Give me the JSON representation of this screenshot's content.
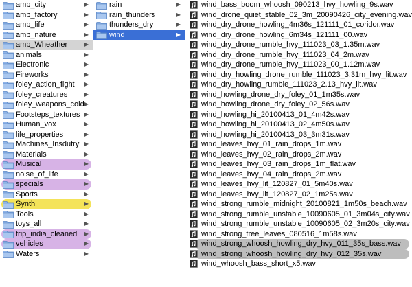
{
  "colors": {
    "selection_blue": "#3a6fd6",
    "selection_grey": "#d4d4d4",
    "tag_purple": "#d7b3e6",
    "tag_yellow": "#f4e35a",
    "file_highlight": "#bdbdbd",
    "folder_blue": "#8fb4e8"
  },
  "column1": [
    {
      "label": "amb_city",
      "state": ""
    },
    {
      "label": "amb_factory",
      "state": ""
    },
    {
      "label": "amb_life",
      "state": ""
    },
    {
      "label": "amb_nature",
      "state": ""
    },
    {
      "label": "amb_Wheather",
      "state": "sel-grey"
    },
    {
      "label": "animals",
      "state": ""
    },
    {
      "label": "Electronic",
      "state": ""
    },
    {
      "label": "Fireworks",
      "state": ""
    },
    {
      "label": "foley_action_fight",
      "state": ""
    },
    {
      "label": "foley_creatures",
      "state": ""
    },
    {
      "label": "foley_weapons_cold",
      "state": ""
    },
    {
      "label": "Footsteps_textures",
      "state": ""
    },
    {
      "label": "Human_vox",
      "state": ""
    },
    {
      "label": "life_properties",
      "state": ""
    },
    {
      "label": "Machines_Insdutry",
      "state": ""
    },
    {
      "label": "Materials",
      "state": ""
    },
    {
      "label": "Musical",
      "state": "tag-purple"
    },
    {
      "label": "noise_of_life",
      "state": ""
    },
    {
      "label": "specials",
      "state": "tag-purple"
    },
    {
      "label": "Sports",
      "state": ""
    },
    {
      "label": "Synth",
      "state": "tag-yellow"
    },
    {
      "label": "Tools",
      "state": ""
    },
    {
      "label": "toys_all",
      "state": ""
    },
    {
      "label": "trip_india_cleaned",
      "state": "tag-purple"
    },
    {
      "label": "vehicles",
      "state": "tag-purple"
    },
    {
      "label": "Waters",
      "state": ""
    }
  ],
  "column2": [
    {
      "label": "rain",
      "state": ""
    },
    {
      "label": "rain_thunders",
      "state": ""
    },
    {
      "label": "thunders_dry",
      "state": ""
    },
    {
      "label": "wind",
      "state": "sel-blue"
    }
  ],
  "column3": [
    {
      "label": "wind_bass_boom_whoosh_090213_hvy_howling_9s.wav",
      "state": ""
    },
    {
      "label": "wind_drone_quiet_stable_02_3m_20090426_city_evening.wav",
      "state": ""
    },
    {
      "label": "wind_dry_drone_howling_4m36s_121111_01_coridor.wav",
      "state": ""
    },
    {
      "label": "wind_dry_drone_howling_6m34s_121111_00.wav",
      "state": ""
    },
    {
      "label": "wind_dry_drone_rumble_hvy_111023_03_1.35m.wav",
      "state": ""
    },
    {
      "label": "wind_dry_drone_rumble_hvy_111023_04_2m.wav",
      "state": ""
    },
    {
      "label": "wind_dry_drone_rumble_hvy_111023_00_1.12m.wav",
      "state": ""
    },
    {
      "label": "wind_dry_howling_drone_rumble_111023_3.31m_hvy_lit.wav",
      "state": ""
    },
    {
      "label": "wind_dry_howling_rumble_111023_2.13_hvy_lit.wav",
      "state": ""
    },
    {
      "label": "wind_howling_drone_dry_foley_01_1m35s.wav",
      "state": ""
    },
    {
      "label": "wind_howling_drone_dry_foley_02_56s.wav",
      "state": ""
    },
    {
      "label": "wind_howling_hi_20100413_01_4m42s.wav",
      "state": ""
    },
    {
      "label": "wind_howling_hi_20100413_02_4m50s.wav",
      "state": ""
    },
    {
      "label": "wind_howling_hi_20100413_03_3m31s.wav",
      "state": ""
    },
    {
      "label": "wind_leaves_hvy_01_rain_drops_1m.wav",
      "state": ""
    },
    {
      "label": "wind_leaves_hvy_02_rain_drops_2m.wav",
      "state": ""
    },
    {
      "label": "wind_leaves_hvy_03_rain_drops_1m_flat.wav",
      "state": ""
    },
    {
      "label": "wind_leaves_hvy_04_rain_drops_2m.wav",
      "state": ""
    },
    {
      "label": "wind_leaves_hvy_lit_120827_01_5m40s.wav",
      "state": ""
    },
    {
      "label": "wind_leaves_hvy_lit_120827_02_1m25s.wav",
      "state": ""
    },
    {
      "label": "wind_strong_rumble_midnight_20100821_1m50s_beach.wav",
      "state": ""
    },
    {
      "label": "wind_strong_rumble_unstable_10090605_01_3m04s_city.wav",
      "state": ""
    },
    {
      "label": "wind_strong_rumble_unstable_10090605_02_3m20s_city.wav",
      "state": ""
    },
    {
      "label": "wind_strong_tree_leaves_080516_1m58s.wav",
      "state": ""
    },
    {
      "label": "wind_strong_whoosh_howling_dry_hvy_011_35s_bass.wav",
      "state": "file-grey"
    },
    {
      "label": "wind_strong_whoosh_howling_dry_hvy_012_35s.wav",
      "state": "file-grey"
    },
    {
      "label": "wind_whoosh_bass_short_x5.wav",
      "state": ""
    }
  ]
}
